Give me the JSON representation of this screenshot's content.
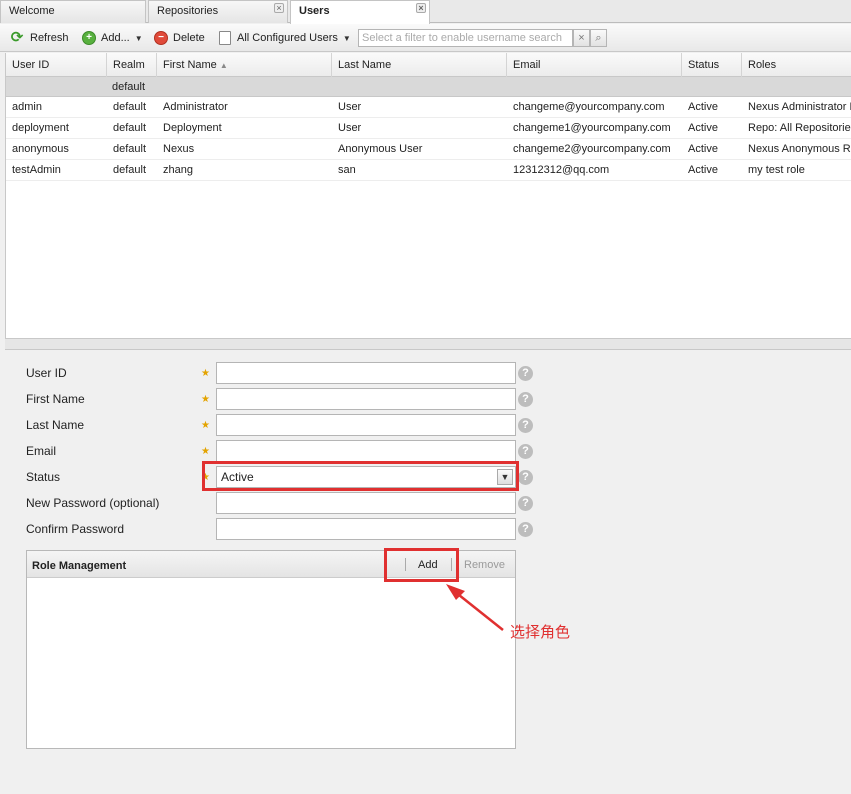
{
  "tabs": [
    {
      "label": "Welcome",
      "active": false,
      "closable": false
    },
    {
      "label": "Repositories",
      "active": false,
      "closable": true
    },
    {
      "label": "Users",
      "active": true,
      "closable": true
    }
  ],
  "toolbar": {
    "refresh_label": "Refresh",
    "add_label": "Add...",
    "delete_label": "Delete",
    "scope_label": "All Configured Users",
    "filter_placeholder": "Select a filter to enable username search"
  },
  "grid": {
    "columns": [
      "User ID",
      "Realm",
      "First Name",
      "Last Name",
      "Email",
      "Status",
      "Roles"
    ],
    "sort_column": "First Name",
    "sort_direction": "asc",
    "group_label": "default",
    "rows": [
      {
        "user_id": "admin",
        "realm": "default",
        "first_name": "Administrator",
        "last_name": "User",
        "email": "changeme@yourcompany.com",
        "status": "Active",
        "roles": "Nexus Administrator Role"
      },
      {
        "user_id": "deployment",
        "realm": "default",
        "first_name": "Deployment",
        "last_name": "User",
        "email": "changeme1@yourcompany.com",
        "status": "Active",
        "roles": "Repo: All Repositories (Full Control)"
      },
      {
        "user_id": "anonymous",
        "realm": "default",
        "first_name": "Nexus",
        "last_name": "Anonymous User",
        "email": "changeme2@yourcompany.com",
        "status": "Active",
        "roles": "Nexus Anonymous Role"
      },
      {
        "user_id": "testAdmin",
        "realm": "default",
        "first_name": "zhang",
        "last_name": "san",
        "email": "12312312@qq.com",
        "status": "Active",
        "roles": "my test role"
      }
    ]
  },
  "form": {
    "user_id_label": "User ID",
    "first_name_label": "First Name",
    "last_name_label": "Last Name",
    "email_label": "Email",
    "status_label": "Status",
    "status_value": "Active",
    "new_password_label": "New Password (optional)",
    "confirm_password_label": "Confirm Password",
    "required_star": "★",
    "help_glyph": "?"
  },
  "roles": {
    "title": "Role Management",
    "add_label": "Add",
    "remove_label": "Remove"
  },
  "annotation": {
    "text": "选择角色",
    "color": "#e03030"
  },
  "colors": {
    "highlight": "#e03030",
    "required_star": "#e3a300",
    "group_row": "#d9d9d9"
  }
}
